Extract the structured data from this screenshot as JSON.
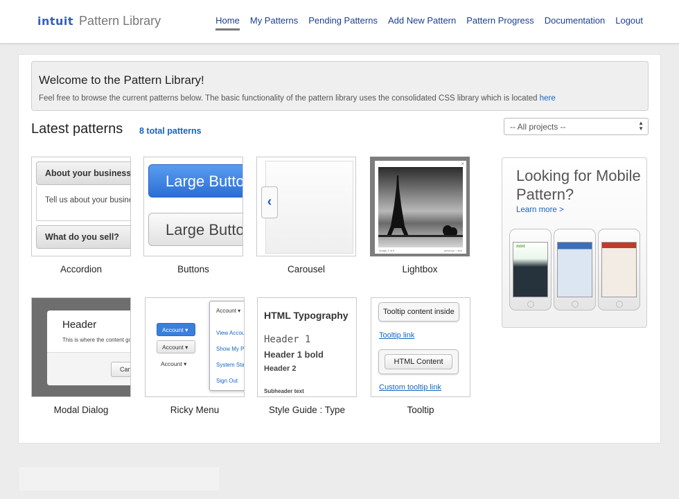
{
  "header": {
    "brand": "intuit",
    "product": "Pattern Library",
    "nav": [
      "Home",
      "My Patterns",
      "Pending Patterns",
      "Add New Pattern",
      "Pattern Progress",
      "Documentation",
      "Logout"
    ],
    "active_nav": "Home"
  },
  "welcome": {
    "title": "Welcome to the Pattern Library!",
    "text": "Feel free to browse the current patterns below. The basic functionality of the pattern library uses the consolidated CSS library which is located ",
    "link": "here"
  },
  "latest": {
    "title": "Latest patterns",
    "count": "8 total patterns"
  },
  "filter": {
    "selected": "-- All projects --"
  },
  "patterns": [
    {
      "name": "Accordion",
      "preview": {
        "h1": "About your business",
        "body": "Tell us about your business",
        "h2": "What do you sell?"
      }
    },
    {
      "name": "Buttons",
      "preview": {
        "b1": "Large Button",
        "b2": "Large Button"
      }
    },
    {
      "name": "Carousel",
      "preview": {
        "arrow": "‹"
      }
    },
    {
      "name": "Lightbox",
      "preview": {
        "caption": "Image 2 of 5",
        "nav": "previous · next"
      }
    },
    {
      "name": "Modal Dialog",
      "preview": {
        "header": "Header",
        "body": "This is where the content goes",
        "button": "Cancel"
      }
    },
    {
      "name": "Ricky Menu",
      "preview": {
        "btn1": "Account ▾",
        "btn2": "Account ▾",
        "btn3": "Account ▾",
        "menu_head": "Account ▾",
        "items": [
          "View Account",
          "Show My Profile",
          "System Status",
          "Sign Out"
        ]
      }
    },
    {
      "name": "Style Guide : Type",
      "preview": {
        "title": "HTML Typography",
        "h1": "Header 1",
        "h1b": "Header 1 bold",
        "h2": "Header 2",
        "sub": "Subheader text"
      }
    },
    {
      "name": "Tooltip",
      "preview": {
        "tip1": "Tooltip content inside",
        "link1": "Tooltip link",
        "tip2": "HTML Content",
        "link2": "Custom tooltip link"
      }
    }
  ],
  "mobile": {
    "title": "Looking for Mobile Pattern?",
    "link": "Learn more >",
    "phone1_label": "mint"
  }
}
